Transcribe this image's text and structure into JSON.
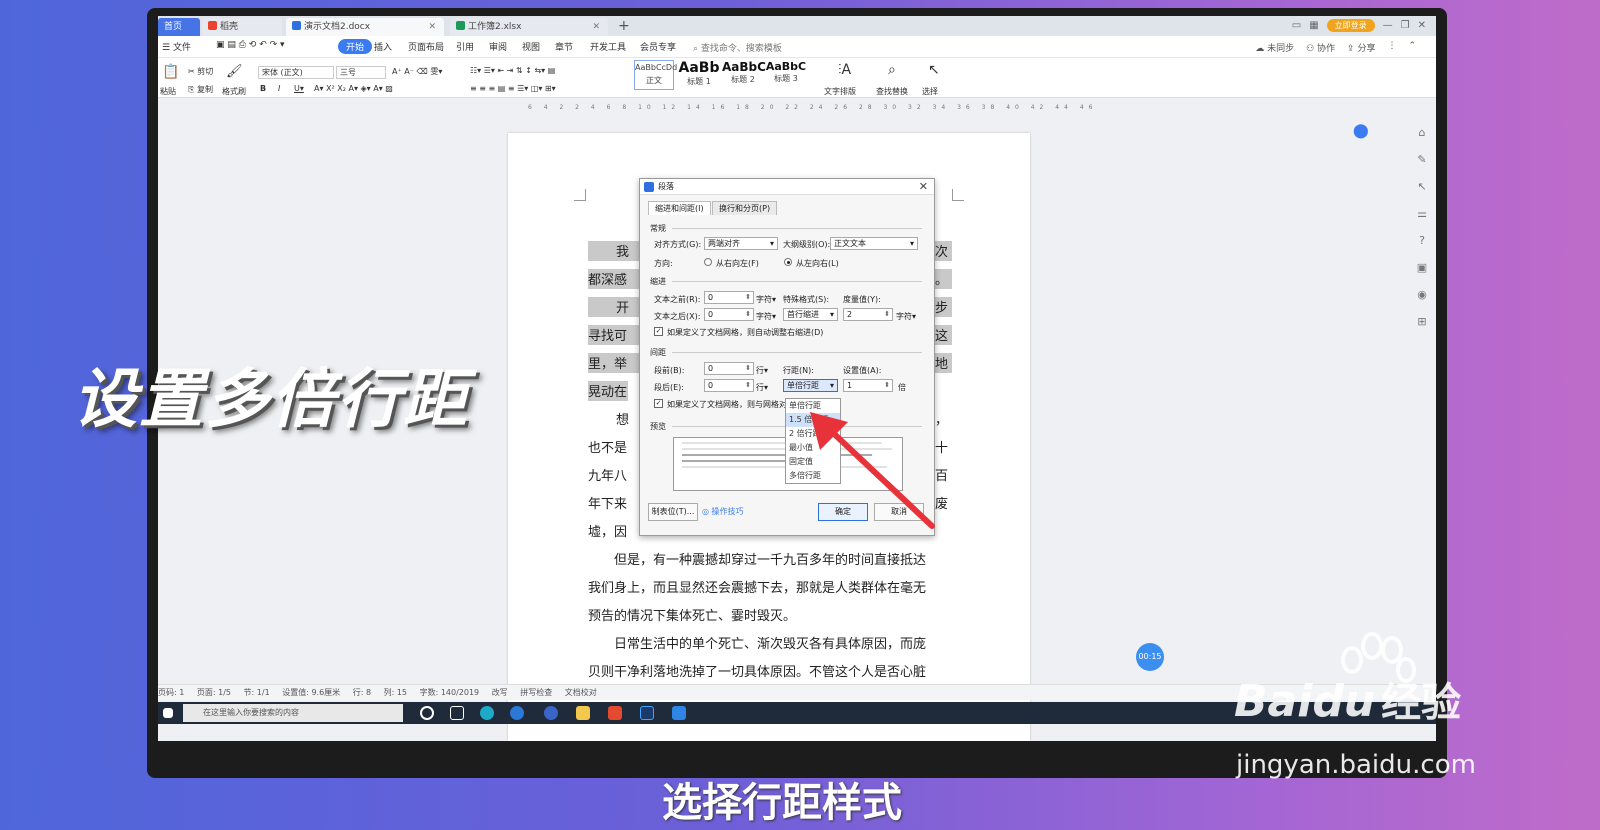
{
  "tabs": {
    "home": "首页",
    "t1": "稻壳",
    "t2": "演示文档2.docx",
    "t3": "工作簿2.xlsx",
    "login": "立即登录"
  },
  "menubar": {
    "file": "文件",
    "start": "开始",
    "insert": "插入",
    "layout": "页面布局",
    "ref": "引用",
    "review": "审阅",
    "view": "视图",
    "chapter": "章节",
    "dev": "开发工具",
    "member": "会员专享",
    "search": "查找命令、搜索模板",
    "sync": "未同步",
    "collab": "协作",
    "share": "分享"
  },
  "ribbon": {
    "paste": "粘贴",
    "cut": "剪切",
    "copy": "复制",
    "painter": "格式刷",
    "font": "宋体 (正文)",
    "size": "三号",
    "style_normal_preview": "AaBbCcDd",
    "style_normal": "正文",
    "style_h1_preview": "AaBb",
    "style_h1": "标题 1",
    "style_h2_preview": "AaBbC",
    "style_h2": "标题 2",
    "style_h3_preview": "AaBbC",
    "style_h3": "标题 3",
    "textlayout": "文字排版",
    "find": "查找替换",
    "select": "选择"
  },
  "ruler": "6 4 2 2 4 6 8 10 12 14 16 18 20 22 24 26 28 30 32 34 36 38 40 42 44 46",
  "doc": {
    "l1": "我",
    "l1r": "两次",
    "l2": "都深感",
    "l2r": "居然。",
    "l3": "开",
    "l3r": "我停步",
    "l4": "寻找可",
    "l4r": "止这",
    "l5": "里，举",
    "l5r": "一颠地",
    "l6": "晃动在",
    "l7": "想",
    "l7r": "废墟，",
    "l8": "也不是",
    "l8r": "元七十",
    "l9": "九年八",
    "l9r": "十九百",
    "l10": "年下来",
    "l10r": "成了废",
    "l11": "墟，因",
    "p2a": "　　但是，有一种震撼却穿过一千九百多年的时间直接抵达",
    "p2b": "我们身上，而且显然还会震撼下去，那就是人类群体在毫无",
    "p2c": "预告的情况下集体死亡、霎时毁灭。",
    "p3a": "　　日常生活中的单个死亡、渐次毁灭各有具体原因，而庞",
    "p3b": "贝则干净利落地洗掉了一切具体原因。不管这个人是否心脏"
  },
  "dialog": {
    "title": "段落",
    "tab_indent": "缩进和间距(I)",
    "tab_break": "换行和分页(P)",
    "general": "常规",
    "align_label": "对齐方式(G):",
    "align_value": "两端对齐",
    "outline_label": "大纲级别(O):",
    "outline_value": "正文文本",
    "direction_label": "方向:",
    "rtl": "从右向左(F)",
    "ltr": "从左向右(L)",
    "indent": "缩进",
    "before_text_label": "文本之前(R):",
    "before_text_value": "0",
    "unit_char": "字符▾",
    "special_label": "特殊格式(S):",
    "special_value": "首行缩进",
    "measure_label": "度量值(Y):",
    "measure_value": "2",
    "after_text_label": "文本之后(X):",
    "after_text_value": "0",
    "grid_indent": "如果定义了文档网格，则自动调整右缩进(D)",
    "spacing": "间距",
    "before_label": "段前(B):",
    "before_value": "0",
    "unit_line": "行▾",
    "after_label": "段后(E):",
    "after_value": "0",
    "linespace_label": "行距(N):",
    "linespace_value": "单倍行距",
    "setvalue_label": "设置值(A):",
    "setvalue_value": "1",
    "unit_times": "倍",
    "grid_align": "如果定义了文档网格，则与网格对齐",
    "preview": "预览",
    "tabs_btn": "制表位(T)...",
    "tips": "操作技巧",
    "ok": "确定",
    "cancel": "取消"
  },
  "dropdown": [
    "单倍行距",
    "1.5 倍行距",
    "2 倍行距",
    "最小值",
    "固定值",
    "多倍行距"
  ],
  "statusbar": {
    "page": "页码: 1",
    "pages": "页面: 1/5",
    "section": "节: 1/1",
    "setting": "设置值: 9.6厘米",
    "row": "行: 8",
    "col": "列: 15",
    "words": "字数: 140/2019",
    "revise": "改写",
    "spell": "拼写检查",
    "proof": "文档校对"
  },
  "timer": "00:15",
  "taskbar": {
    "search": "在这里输入你要搜索的内容"
  },
  "caption": "设置多倍行距",
  "subtitle": "选择行距样式",
  "watermark": {
    "logo": "Bai",
    "logo_du": "du",
    "logo_sub": "经验",
    "url": "jingyan.baidu.com"
  },
  "colors": {
    "accent": "#3a7bf1",
    "arrow": "#e8323a",
    "highlight": "#c9c9c9"
  }
}
